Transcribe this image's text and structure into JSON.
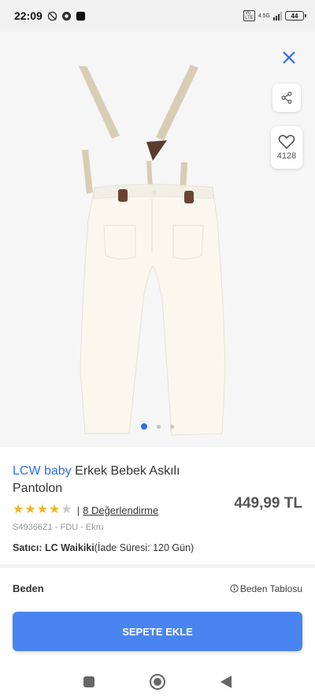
{
  "status_bar": {
    "time": "22:09",
    "network": "4.5G",
    "battery": "44"
  },
  "gallery": {
    "favorite_count": "4128",
    "page_count": 3,
    "active_page": 1
  },
  "product": {
    "brand": "LCW baby",
    "name": "Erkek Bebek Askılı Pantolon",
    "price": "449,99 TL",
    "rating": 4,
    "rating_max": 5,
    "reviews_label": "8 Değerlendirme",
    "sku": "S49366Z1 - FDU - Ekru",
    "seller_label": "Satıcı: LC Waikiki",
    "return_policy": "(İade Süresi: 120 Gün)"
  },
  "size": {
    "label": "Beden",
    "chart_label": "Beden Tablosu"
  },
  "cta": {
    "add_to_cart": "SEPETE EKLE"
  },
  "colors": {
    "accent": "#2f6fe8",
    "button": "#4a84f0",
    "star": "#f0b429"
  }
}
